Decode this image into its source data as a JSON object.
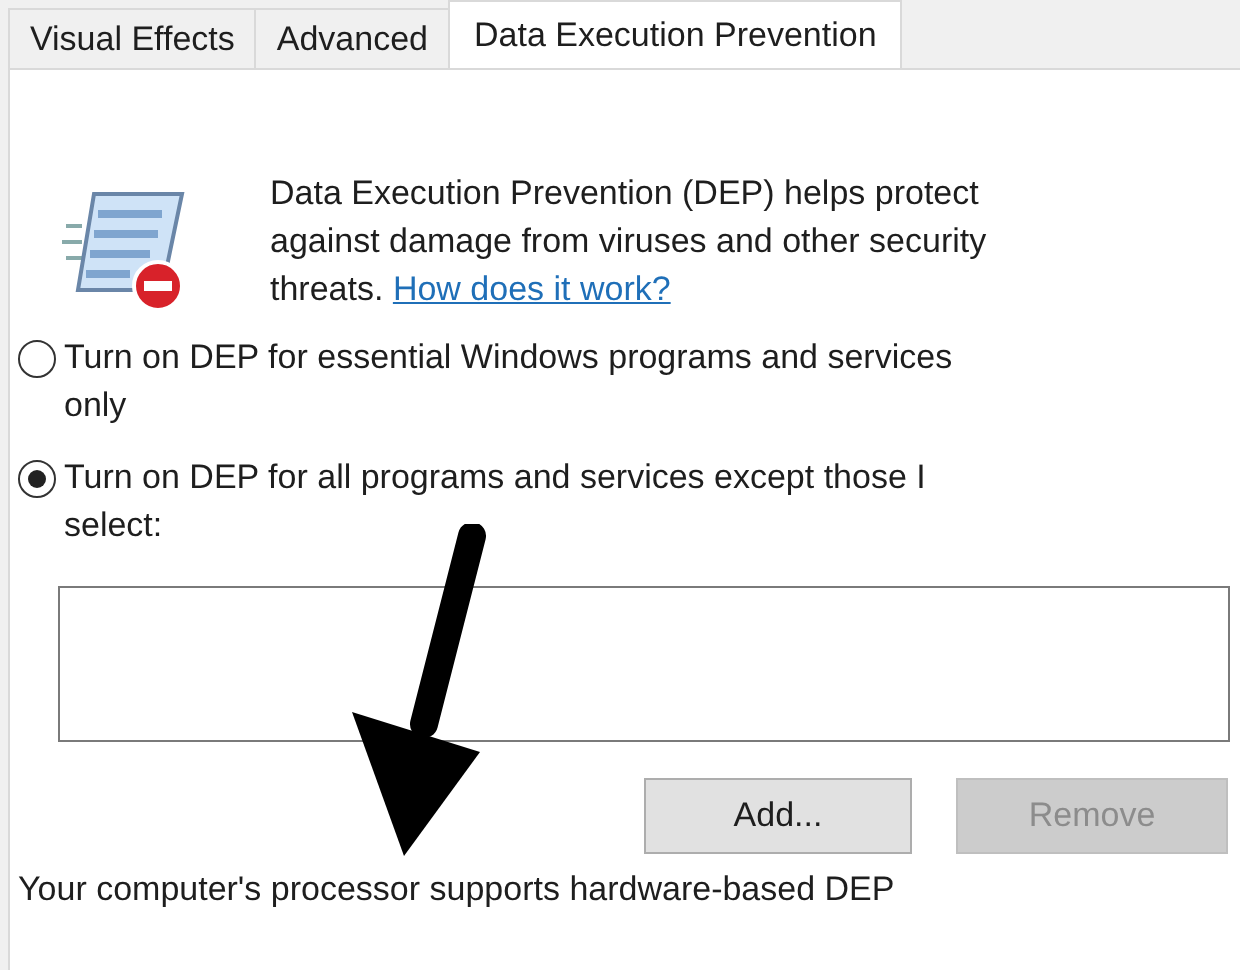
{
  "tabs": [
    {
      "label": "Visual Effects",
      "selected": false
    },
    {
      "label": "Advanced",
      "selected": false
    },
    {
      "label": "Data Execution Prevention",
      "selected": true
    }
  ],
  "intro": {
    "text": "Data Execution Prevention (DEP) helps protect against damage from viruses and other security threats.",
    "link": "How does it work?"
  },
  "options": [
    {
      "label": "Turn on DEP for essential Windows programs and services only",
      "selected": false
    },
    {
      "label": "Turn on DEP for all programs and services except those I select:",
      "selected": true
    }
  ],
  "buttons": [
    {
      "label": "Add...",
      "disabled": false
    },
    {
      "label": "Remove",
      "disabled": true
    }
  ],
  "footer": "Your computer's processor supports hardware-based DEP"
}
